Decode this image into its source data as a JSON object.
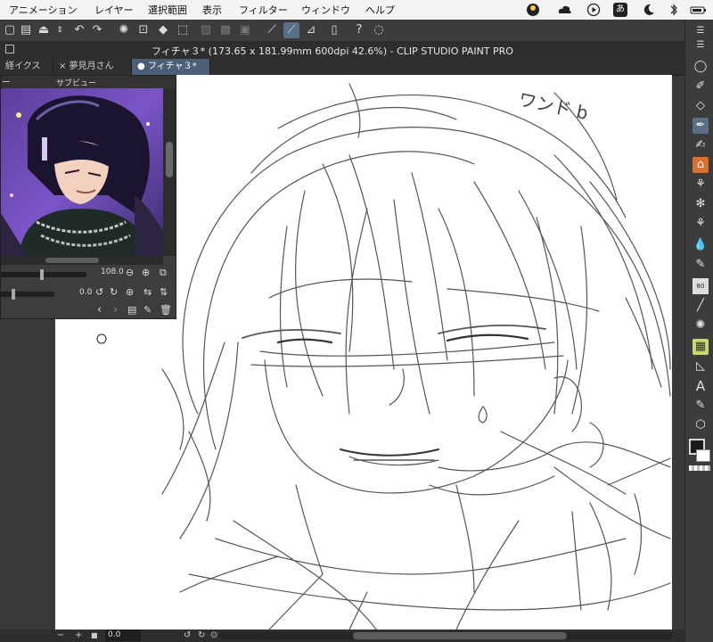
{
  "menubar": {
    "items": [
      "アニメーション",
      "レイヤー",
      "選択範囲",
      "表示",
      "フィルター",
      "ウィンドウ",
      "ヘルプ"
    ],
    "status_icons": [
      "user-icon",
      "cloud-icon",
      "play-icon",
      "input-method-icon",
      "moon-icon",
      "bluetooth-icon",
      "battery-icon"
    ],
    "input_method_label": "あ"
  },
  "titlebar": {
    "title": "フィチャ３* (173.65 x 181.99mm 600dpi 42.6%)  - CLIP STUDIO PAINT PRO"
  },
  "tabs": [
    {
      "label": "経イクス",
      "active": false
    },
    {
      "label": "夢見月さん",
      "active": false
    },
    {
      "label": "フィチャ３*",
      "active": true
    }
  ],
  "navigator": {
    "title": "サブビュー",
    "zoom_value": "108.0",
    "rotate_value": "0.0"
  },
  "canvas": {
    "handwritten_note": "ワンド b"
  },
  "statusbar": {
    "zoom_field": "0.0"
  },
  "colors": {
    "ui_dark": "#3a3a3a",
    "accent_selected": "#5a6e86",
    "canvas": "#ffffff",
    "main_color": "#1b1b1b",
    "orange_tool": "#d9702f"
  }
}
